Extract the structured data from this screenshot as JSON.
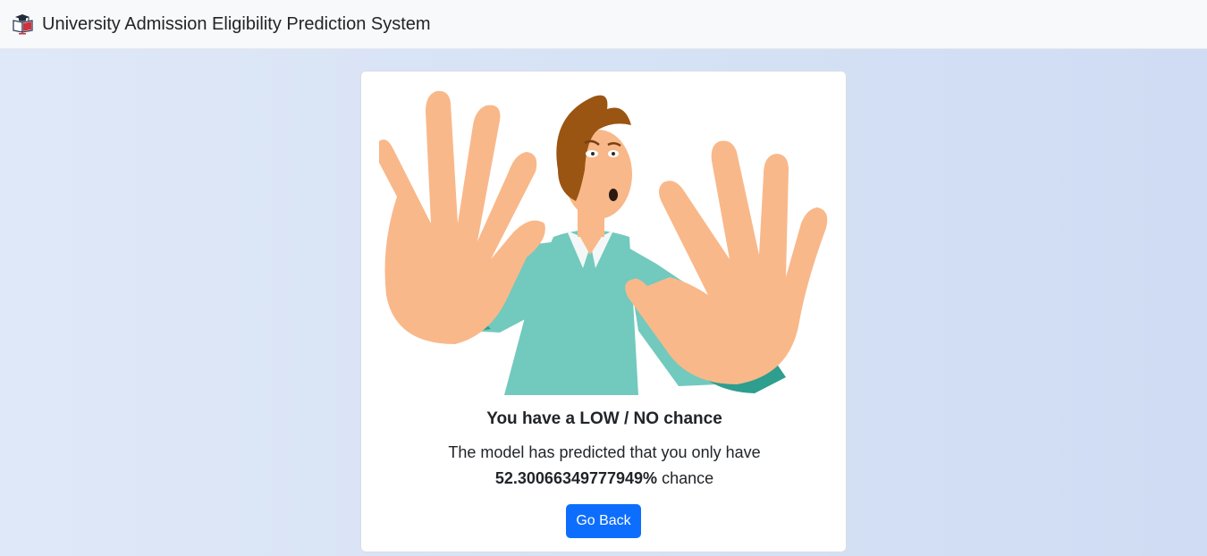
{
  "navbar": {
    "brand_text": "University Admission Eligibility Prediction System",
    "logo_icon": "graduation-book-icon"
  },
  "result": {
    "illustration": "man-raising-hands-stop-illustration",
    "title": "You have a LOW / NO chance",
    "line1": "The model has predicted that you only have",
    "percentage": "52.30066349777949%",
    "suffix": " chance",
    "button_label": "Go Back"
  },
  "colors": {
    "page_bg": "#d6e2f5",
    "navbar_bg": "#f8f9fa",
    "button": "#0d6efd",
    "skin": "#f9b88a",
    "shirt": "#72c9bd",
    "hair": "#9a5512"
  }
}
